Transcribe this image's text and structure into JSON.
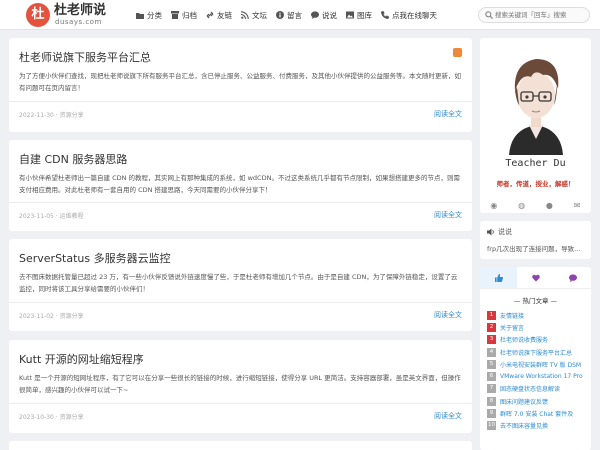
{
  "logo": {
    "mark": "杜",
    "name": "杜老师说",
    "domain": "dusays.com"
  },
  "nav": [
    {
      "icon": "folder-icon",
      "label": "分类"
    },
    {
      "icon": "archive-icon",
      "label": "归档"
    },
    {
      "icon": "link-icon",
      "label": "友链"
    },
    {
      "icon": "rss-icon",
      "label": "文坛"
    },
    {
      "icon": "info-icon",
      "label": "留言"
    },
    {
      "icon": "chat-icon",
      "label": "说说"
    },
    {
      "icon": "image-icon",
      "label": "图库"
    },
    {
      "icon": "phone-icon",
      "label": "点我在线聊天"
    }
  ],
  "search": {
    "placeholder": "搜索关键词「回车」搜索"
  },
  "posts": [
    {
      "title": "杜老师说旗下服务平台汇总",
      "excerpt": "为了方便小伙伴们查找，现把杜老师说旗下所有服务平台汇总，含已停止服务、公益服务、付费服务，及其他小伙伴提供的公益服务等。本文随时更新，如有问题可在页内留言！",
      "meta": "2022-11-30 · 资源分享",
      "more": "阅读全文"
    },
    {
      "title": "自建 CDN 服务器思路",
      "excerpt": "有小伙伴希望杜老师出一篇自建 CDN 的教程，其实网上有那种集成的系统，如 wdCDN。不过这类系统几乎都有节点限制，如果想搭建更多的节点，则需支付相应费用。对此杜老师有一套自用的 CDN 搭建思路，今天同需要的小伙伴分享下！",
      "meta": "2023-11-05 · 运维教程",
      "more": "阅读全文"
    },
    {
      "title": "ServerStatus 多服务器云监控",
      "excerpt": "去不图床数据托管量已超过 23 万，有一些小伙伴反馈说外链速度慢了些，于是杜老师有增加几个节点。由于是自建 CDN，为了保障外链稳定，设置了云监控，同时将该工具分享给需要的小伙伴们！",
      "meta": "2023-11-02 · 资源分享",
      "more": "阅读全文"
    },
    {
      "title": "Kutt 开源的网址缩短程序",
      "excerpt": "Kutt 是一个开源的短网址程序，有了它可以在分享一些很长的链接的时候，进行缩短链接，使得分享 URL 更简洁。支持容器部署，虽是英文界面，但操作很简单，感兴趣的小伙伴可以试一下~",
      "meta": "2023-10-30 · 资源分享",
      "more": "阅读全文"
    }
  ],
  "profile": {
    "name": "Teacher Du",
    "motto": "师者，传道，授业，解惑！"
  },
  "shuoshuo": {
    "title": "说说",
    "text": "frp几次出现了连接问题，导致..."
  },
  "hot": {
    "title": "— 热门文章 —",
    "items": [
      {
        "num": "1",
        "title": "友情链接"
      },
      {
        "num": "2",
        "title": "关于留言"
      },
      {
        "num": "3",
        "title": "杜老师说收费服务"
      },
      {
        "num": "4",
        "title": "杜老师说旗下服务平台汇总"
      },
      {
        "num": "5",
        "title": "小米电视安装群晖 TV 版 DSM"
      },
      {
        "num": "6",
        "title": "VMware Workstation 17 Pro"
      },
      {
        "num": "7",
        "title": "固态硬盘状态信息解读"
      },
      {
        "num": "8",
        "title": "图床问题建议反馈"
      },
      {
        "num": "9",
        "title": "群晖 7.0 安装 Chat 套件及"
      },
      {
        "num": "10",
        "title": "去不图床容量见换"
      }
    ]
  },
  "colors": {
    "accent": "#2d8bd1",
    "brand": "#e4533e",
    "hot_num": "#d9363e"
  }
}
